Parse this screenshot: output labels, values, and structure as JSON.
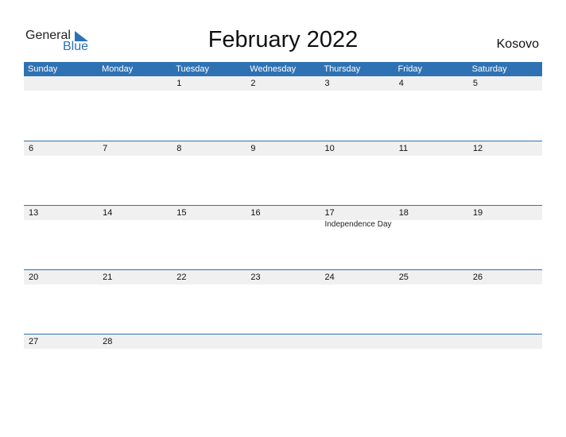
{
  "logo": {
    "line1": "General",
    "line2": "Blue",
    "icon": "triangle-flag-icon"
  },
  "title": "February 2022",
  "country": "Kosovo",
  "colors": {
    "accent": "#2f72b4",
    "strip": "#f0f0f0"
  },
  "weekdays": [
    "Sunday",
    "Monday",
    "Tuesday",
    "Wednesday",
    "Thursday",
    "Friday",
    "Saturday"
  ],
  "weeks": [
    [
      {
        "d": ""
      },
      {
        "d": ""
      },
      {
        "d": "1"
      },
      {
        "d": "2"
      },
      {
        "d": "3"
      },
      {
        "d": "4"
      },
      {
        "d": "5"
      }
    ],
    [
      {
        "d": "6"
      },
      {
        "d": "7"
      },
      {
        "d": "8"
      },
      {
        "d": "9"
      },
      {
        "d": "10"
      },
      {
        "d": "11"
      },
      {
        "d": "12"
      }
    ],
    [
      {
        "d": "13"
      },
      {
        "d": "14"
      },
      {
        "d": "15"
      },
      {
        "d": "16"
      },
      {
        "d": "17",
        "e": "Independence Day"
      },
      {
        "d": "18"
      },
      {
        "d": "19"
      }
    ],
    [
      {
        "d": "20"
      },
      {
        "d": "21"
      },
      {
        "d": "22"
      },
      {
        "d": "23"
      },
      {
        "d": "24"
      },
      {
        "d": "25"
      },
      {
        "d": "26"
      }
    ],
    [
      {
        "d": "27"
      },
      {
        "d": "28"
      },
      {
        "d": ""
      },
      {
        "d": ""
      },
      {
        "d": ""
      },
      {
        "d": ""
      },
      {
        "d": ""
      }
    ]
  ]
}
